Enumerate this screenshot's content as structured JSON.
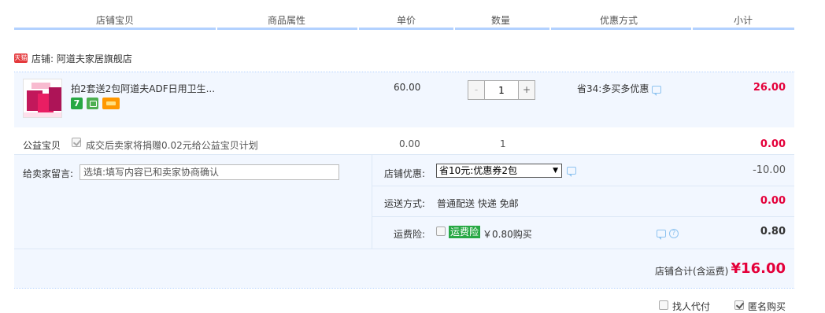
{
  "header": {
    "col_shop_item": "店铺宝贝",
    "col_attributes": "商品属性",
    "col_unit_price": "单价",
    "col_quantity": "数量",
    "col_discount": "优惠方式",
    "col_subtotal": "小计"
  },
  "shop": {
    "tag": "天猫",
    "name_label": "店铺: 阿道夫家居旗舰店"
  },
  "item": {
    "title": "拍2套送2包阿道夫ADF日用卫生...",
    "badge_seven": "7",
    "price": "60.00",
    "qty_minus": "-",
    "qty_value": "1",
    "qty_plus": "+",
    "promo": "省34:多买多优惠",
    "subtotal": "26.00"
  },
  "charity": {
    "label": "公益宝贝",
    "text": "成交后卖家将捐赠0.02元给公益宝贝计划",
    "price": "0.00",
    "qty": "1",
    "subtotal": "0.00"
  },
  "message": {
    "label": "给卖家留言:",
    "placeholder": "选填:填写内容已和卖家协商确认"
  },
  "shop_discount": {
    "label": "店铺优惠:",
    "selected": "省10元:优惠券2包",
    "value": "-10.00"
  },
  "shipping": {
    "label": "运送方式:",
    "text": "普通配送 快递 免邮",
    "value": "0.00"
  },
  "insurance": {
    "label": "运费险:",
    "tag": "运费险",
    "text": "￥0.80购买",
    "help": "?",
    "value": "0.80"
  },
  "total": {
    "label": "店铺合计(含运费)",
    "value": "¥16.00"
  },
  "footer": {
    "proxy_pay": "找人代付",
    "anonymous": "匿名购买"
  },
  "colors": {
    "accent_blue": "#b2d1ff",
    "price_red": "#e4003a",
    "panel_bg": "#f2f7ff",
    "tag_green": "#27a844"
  }
}
